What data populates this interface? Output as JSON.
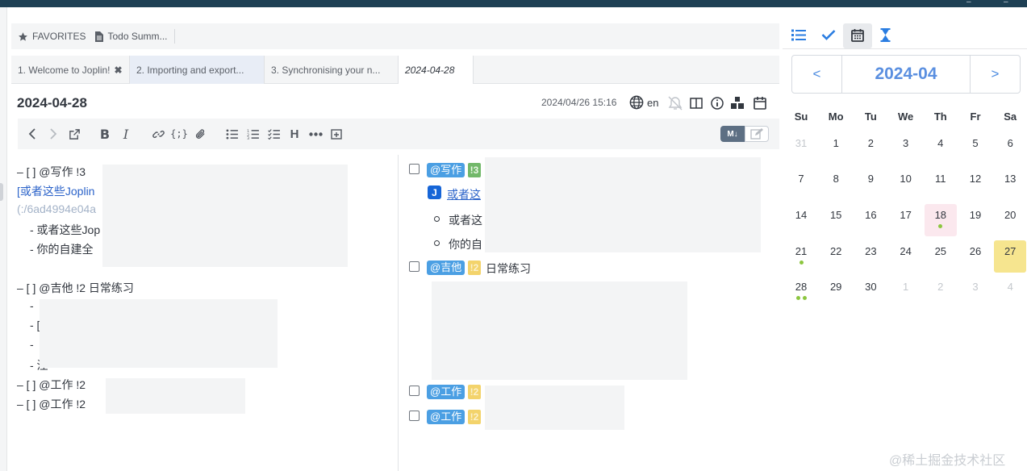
{
  "favorites": {
    "label": "FAVORITES",
    "note": "Todo Summ..."
  },
  "tabs": [
    {
      "label": "1. Welcome to Joplin!",
      "close": "✖"
    },
    {
      "label": "2. Importing and export..."
    },
    {
      "label": "3. Synchronising your n..."
    },
    {
      "label": "2024-04-28"
    }
  ],
  "note": {
    "title": "2024-04-28",
    "updated": "2024/04/26 15:16",
    "language": "en"
  },
  "toolbar": {
    "md_label": "M↓"
  },
  "editor": {
    "lines": [
      "– [ ] @写作 !3",
      "[或者这些Joplin",
      "(:/6ad4994e04a",
      "- 或者这些Jop",
      "- 你的自建全",
      "– [ ] @吉他 !2 日常练习",
      "-",
      "- [",
      "- ",
      "- 注",
      "– [ ] @工作 !2",
      "– [ ] @工作 !2"
    ]
  },
  "viewer": {
    "tag_write": "@写作",
    "tag_guitar": "@吉他",
    "tag_work": "@工作",
    "pri3": "!3",
    "pri2": "!2",
    "link_text": "或者这",
    "jicon": "J",
    "bullet1": "或者这",
    "bullet2": "你的自",
    "guitar_text": "日常练习"
  },
  "calendar": {
    "month": "2024-04",
    "prev": "<",
    "next": ">",
    "weekdays": [
      "Su",
      "Mo",
      "Tu",
      "We",
      "Th",
      "Fr",
      "Sa"
    ],
    "weeks": [
      [
        "31",
        "1",
        "2",
        "3",
        "4",
        "5",
        "6"
      ],
      [
        "7",
        "8",
        "9",
        "10",
        "11",
        "12",
        "13"
      ],
      [
        "14",
        "15",
        "16",
        "17",
        "18",
        "19",
        "20"
      ],
      [
        "21",
        "22",
        "23",
        "24",
        "25",
        "26",
        "27"
      ],
      [
        "28",
        "29",
        "30",
        "1",
        "2",
        "3",
        "4"
      ]
    ],
    "today": "27",
    "marked": "18",
    "dot_counts": {
      "18": 1,
      "21": 1,
      "28": 2
    },
    "accent": "#4a8ae0",
    "today_color": "#f6e58f",
    "marked_color": "#fbe8ee"
  },
  "watermark": "@稀土掘金技术社区",
  "icons": {
    "favorites": "star-icon",
    "note": "document-icon",
    "language": "globe-icon",
    "alarm": "alarm-icon",
    "layout": "split-view-icon",
    "info": "info-icon",
    "plugin": "cubes-icon",
    "calendar": "calendar-icon",
    "list": "list-icon",
    "done": "check-icon",
    "timer": "hourglass-icon"
  }
}
